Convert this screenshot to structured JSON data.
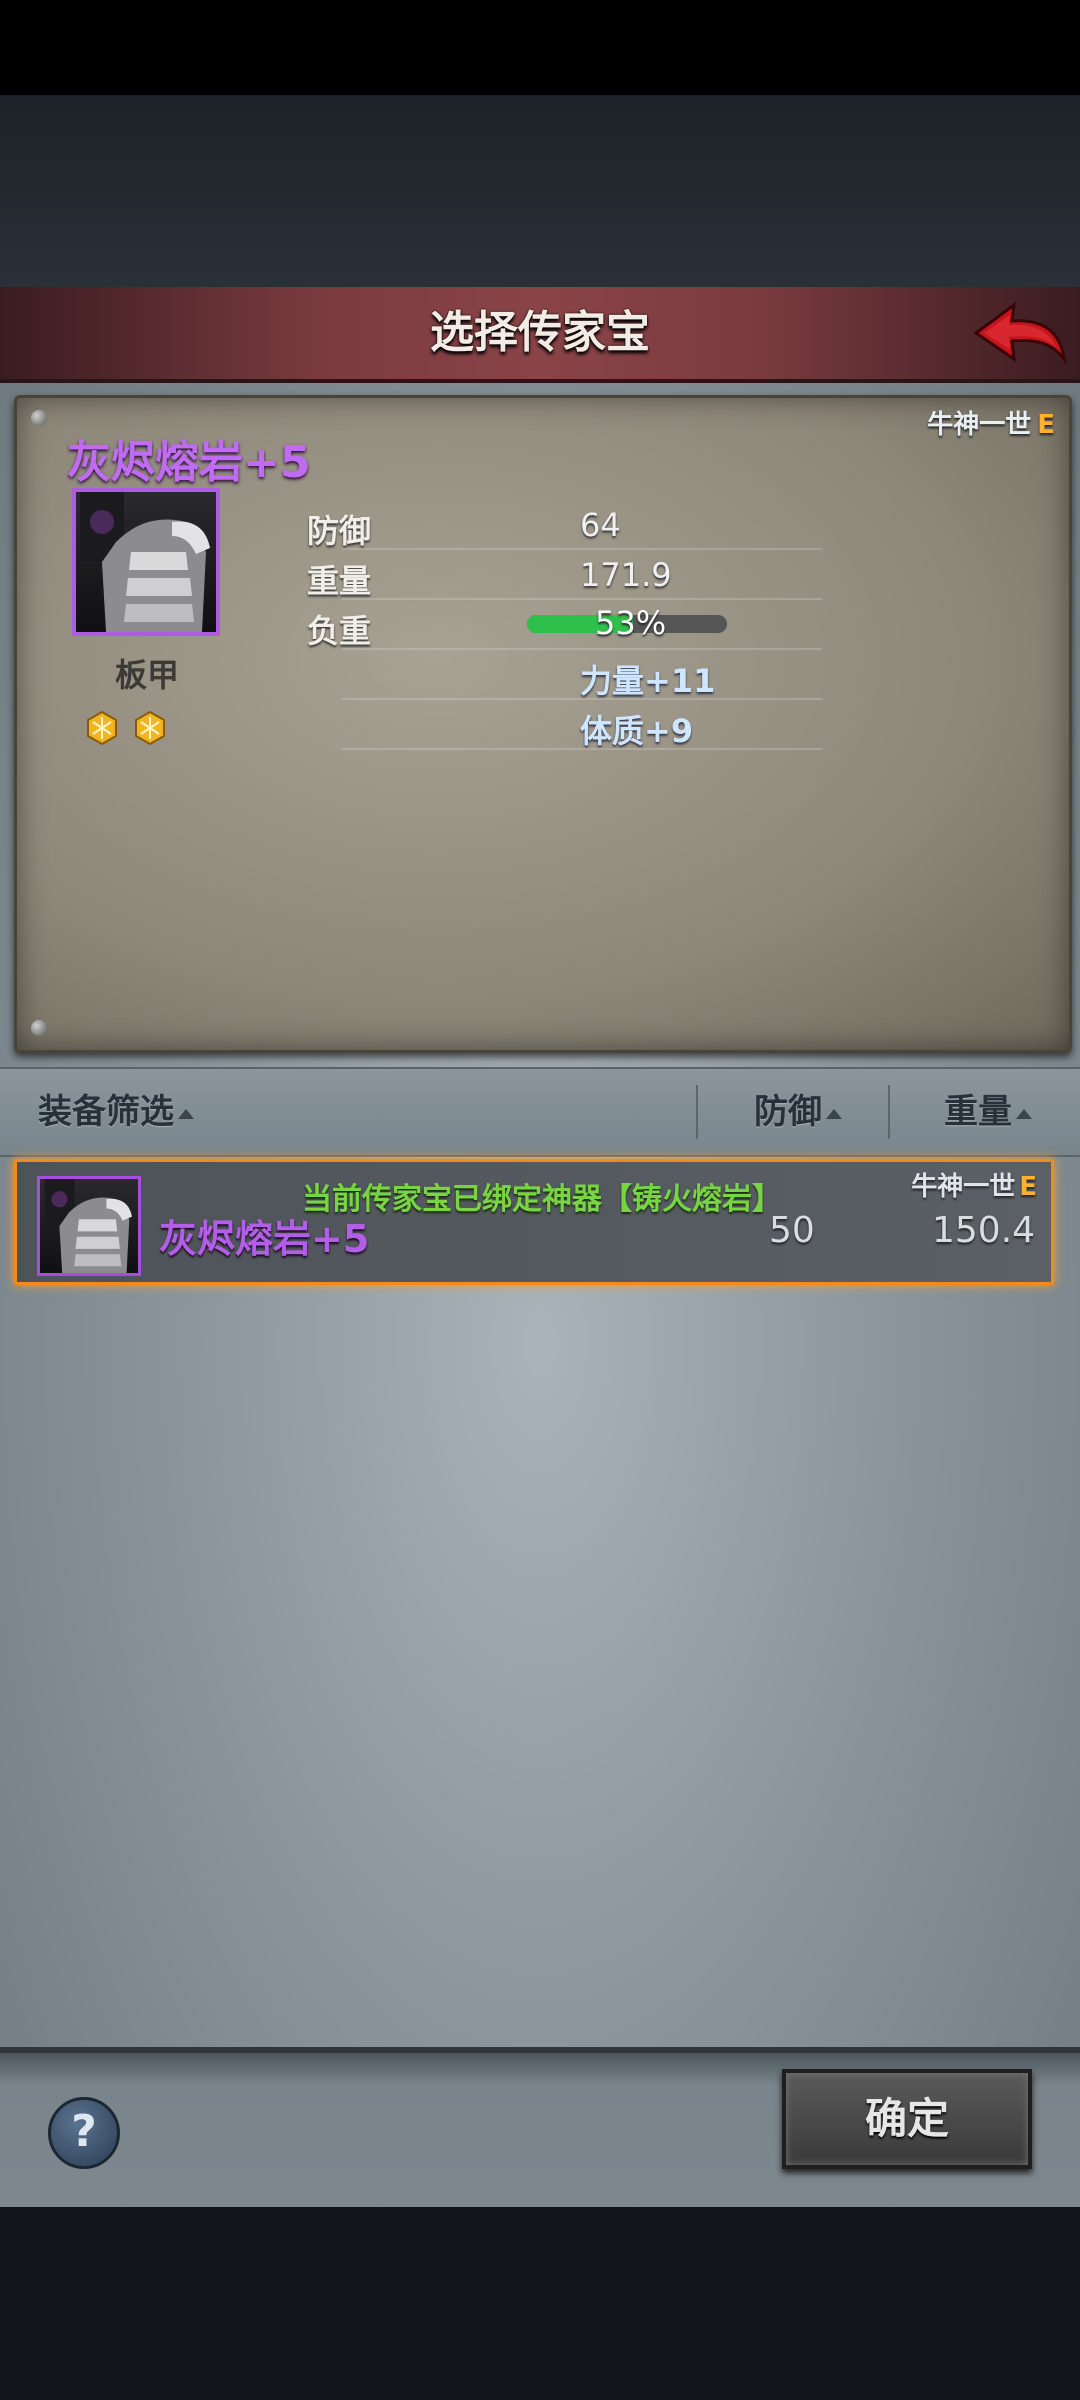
{
  "dialog": {
    "title": "选择传家宝"
  },
  "selected_item": {
    "owner": "牛神一世",
    "owner_grade": "E",
    "name": "灰烬熔岩+5",
    "type": "板甲",
    "stats": [
      {
        "label": "防御",
        "value": "64"
      },
      {
        "label": "重量",
        "value": "171.9"
      },
      {
        "label": "负重",
        "value": "53%"
      }
    ],
    "load_fraction": 0.53,
    "bonuses": [
      "力量+11",
      "体质+9"
    ]
  },
  "filter_bar": {
    "filter_label": "装备筛选",
    "defense_label": "防御",
    "weight_label": "重量"
  },
  "list": [
    {
      "notice": "当前传家宝已绑定神器【铸火熔岩】",
      "owner": "牛神一世",
      "owner_grade": "E",
      "name": "灰烬熔岩+5",
      "defense": "50",
      "weight": "150.4"
    }
  ],
  "footer": {
    "help_label": "?",
    "confirm_label": "确定"
  },
  "colors": {
    "item_purple": "#c06cf2",
    "grade_orange": "#ffb12e",
    "notice_green": "#79d443",
    "selected_border": "#f28a1c"
  }
}
